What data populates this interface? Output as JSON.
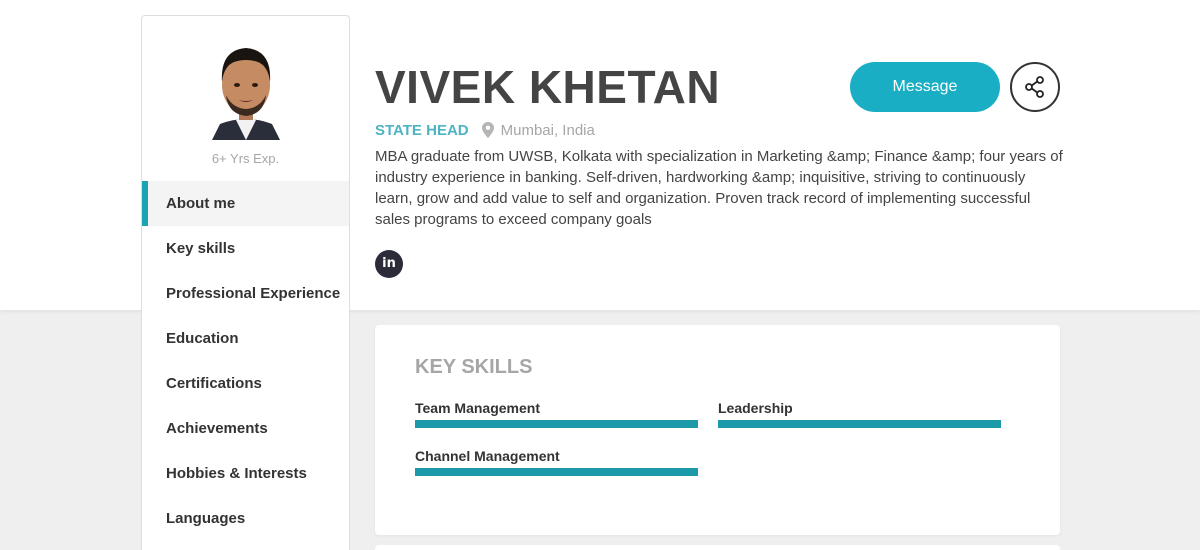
{
  "profile": {
    "name": "VIVEK KHETAN",
    "role": "STATE HEAD",
    "location": "Mumbai, India",
    "experience": "6+ Yrs Exp.",
    "bio": "MBA graduate from UWSB, Kolkata with specialization in Marketing &amp; Finance &amp; four years of industry experience in banking. Self-driven, hardworking &amp; inquisitive, striving to continuously learn, grow and add value to self and organization. Proven track record of implementing successful sales programs to exceed company goals"
  },
  "actions": {
    "message_label": "Message",
    "share_icon": "share-icon"
  },
  "social": {
    "linkedin_label": "in"
  },
  "nav": {
    "items": [
      {
        "label": "About me",
        "active": true
      },
      {
        "label": "Key skills"
      },
      {
        "label": "Professional Experience"
      },
      {
        "label": "Education"
      },
      {
        "label": "Certifications"
      },
      {
        "label": "Achievements"
      },
      {
        "label": "Hobbies & Interests"
      },
      {
        "label": "Languages"
      }
    ]
  },
  "skills": {
    "title": "KEY SKILLS",
    "items": [
      {
        "label": "Team Management",
        "level": 1.0
      },
      {
        "label": "Leadership",
        "level": 1.0
      },
      {
        "label": "Channel Management",
        "level": 1.0
      }
    ]
  },
  "colors": {
    "accent": "#1aaec4",
    "skill_bar": "#1c9aaa",
    "role": "#4eb3c3"
  }
}
